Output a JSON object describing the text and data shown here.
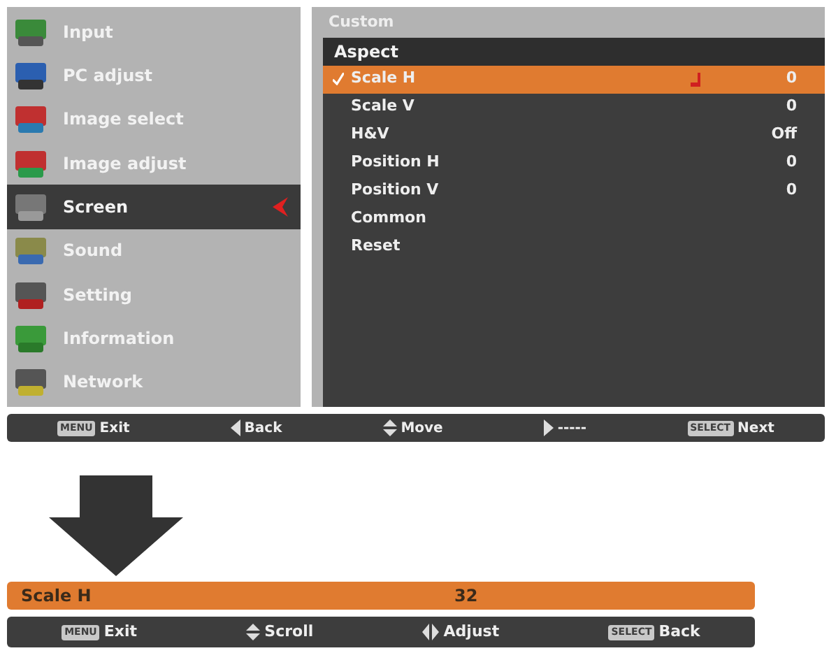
{
  "main_menu": [
    {
      "label": "Input",
      "selected": false
    },
    {
      "label": "PC adjust",
      "selected": false
    },
    {
      "label": "Image select",
      "selected": false
    },
    {
      "label": "Image adjust",
      "selected": false
    },
    {
      "label": "Screen",
      "selected": true
    },
    {
      "label": "Sound",
      "selected": false
    },
    {
      "label": "Setting",
      "selected": false
    },
    {
      "label": "Information",
      "selected": false
    },
    {
      "label": "Network",
      "selected": false
    }
  ],
  "submenu": {
    "title": "Custom",
    "header": "Aspect",
    "items": [
      {
        "label": "Scale H",
        "value": "0",
        "selected": true,
        "checked": true
      },
      {
        "label": "Scale V",
        "value": "0",
        "selected": false,
        "checked": false
      },
      {
        "label": "H&V",
        "value": "Off",
        "selected": false,
        "checked": false
      },
      {
        "label": "Position H",
        "value": "0",
        "selected": false,
        "checked": false
      },
      {
        "label": "Position V",
        "value": "0",
        "selected": false,
        "checked": false
      },
      {
        "label": "Common",
        "selected": false,
        "checked": false
      },
      {
        "label": "Reset",
        "selected": false,
        "checked": false
      }
    ]
  },
  "guide_bar": [
    {
      "kind": "key",
      "key": "MENU",
      "label": "Exit"
    },
    {
      "kind": "left",
      "label": "Back"
    },
    {
      "kind": "updown",
      "label": "Move"
    },
    {
      "kind": "right",
      "label": "-----"
    },
    {
      "kind": "key",
      "key": "SELECT",
      "label": "Next"
    }
  ],
  "adjust_bar": {
    "label": "Scale H",
    "value": "32"
  },
  "adjust_guide_bar": [
    {
      "kind": "key",
      "key": "MENU",
      "label": "Exit"
    },
    {
      "kind": "updown",
      "label": "Scroll"
    },
    {
      "kind": "leftright",
      "label": "Adjust"
    },
    {
      "kind": "key",
      "key": "SELECT",
      "label": "Back"
    }
  ]
}
